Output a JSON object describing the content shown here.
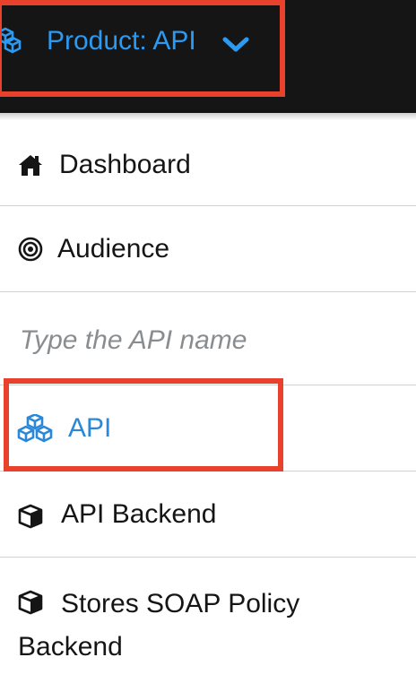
{
  "header": {
    "product_selector_label": "Product: API",
    "icon": "cubes-icon",
    "accent_color": "#2b9af3",
    "background_color": "#151515"
  },
  "nav": {
    "items": [
      {
        "label": "Dashboard",
        "icon": "home-icon",
        "active": false
      },
      {
        "label": "Audience",
        "icon": "bullseye-icon",
        "active": false
      }
    ],
    "search": {
      "placeholder": "Type the API name",
      "value": ""
    },
    "api_items": [
      {
        "label": "API",
        "icon": "cubes-icon",
        "active": true
      },
      {
        "label": "API Backend",
        "icon": "cube-icon",
        "active": false
      },
      {
        "label": "Stores SOAP Policy Backend",
        "icon": "cube-icon",
        "active": false
      }
    ]
  },
  "highlight_color": "#e8412c"
}
